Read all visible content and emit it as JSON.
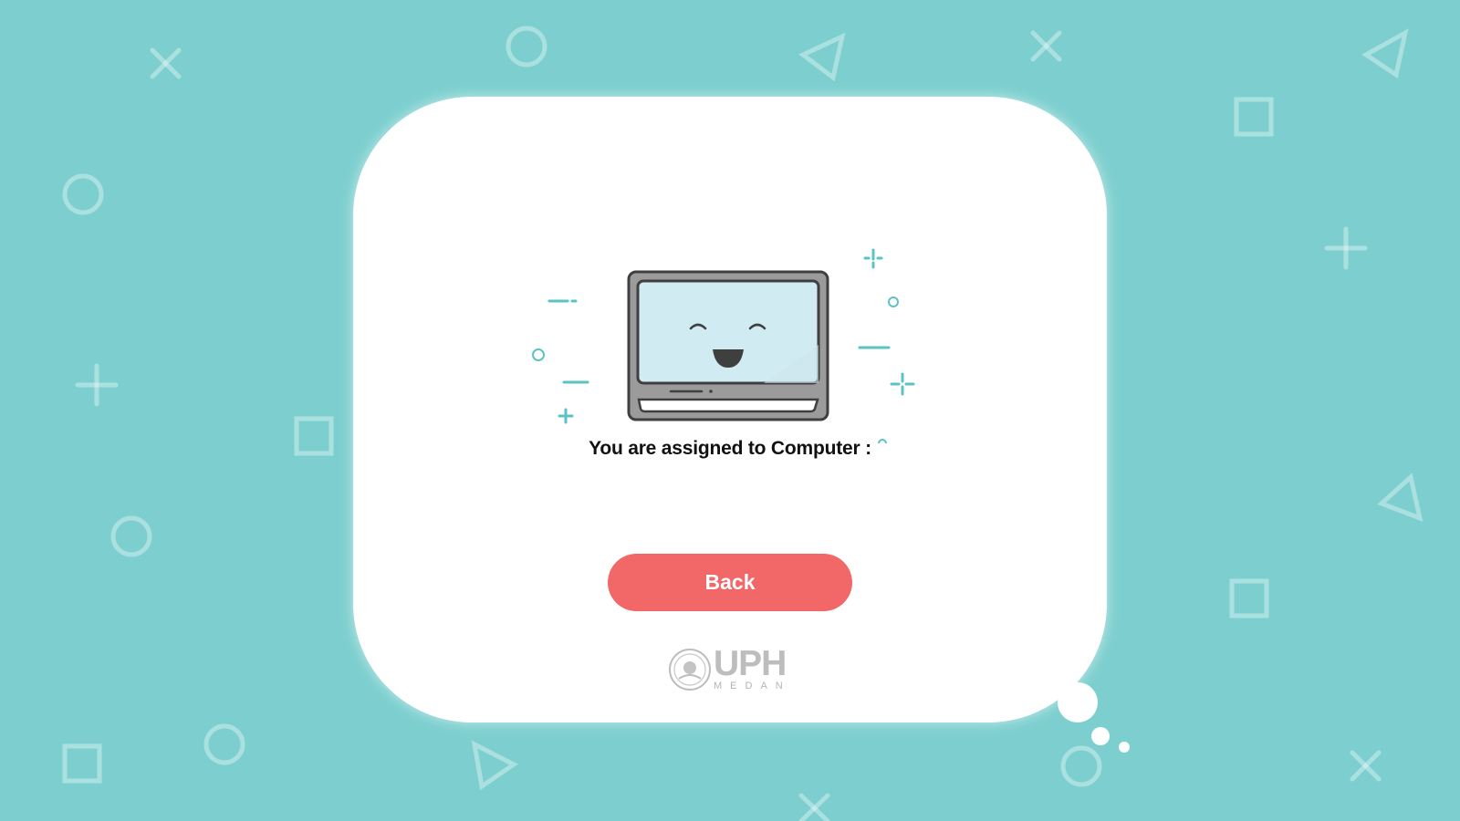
{
  "message": {
    "text": "You are assigned to Computer :"
  },
  "actions": {
    "back_label": "Back"
  },
  "logo": {
    "name": "UPH",
    "subtitle": "MEDAN"
  },
  "colors": {
    "background": "#7dcfcf",
    "card": "#ffffff",
    "accent": "#5bc3c3",
    "button": "#f26767",
    "screen": "#d0ebf2"
  },
  "icons": {
    "illustration": "happy-computer-icon",
    "logo_emblem": "university-seal-icon",
    "background": [
      "x-shape-icon",
      "circle-shape-icon",
      "triangle-shape-icon",
      "square-shape-icon",
      "plus-shape-icon"
    ]
  }
}
